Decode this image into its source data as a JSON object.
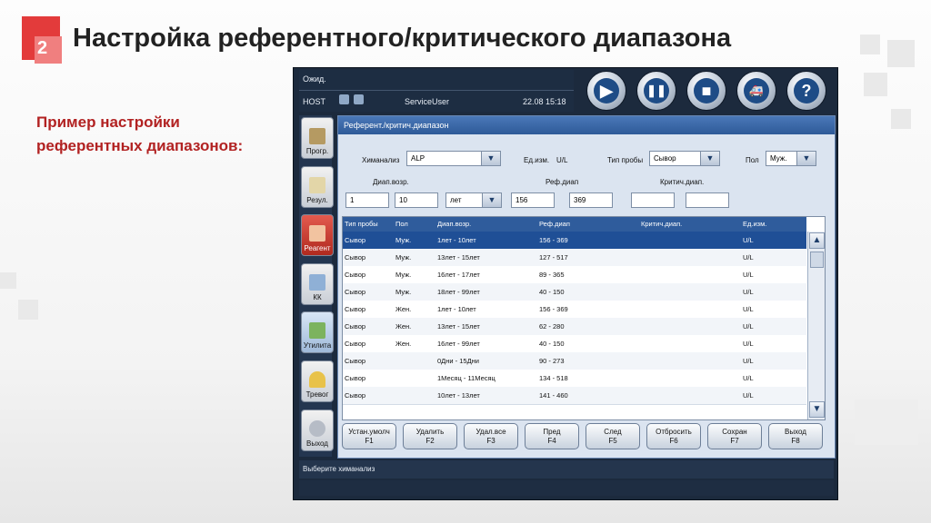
{
  "slide": {
    "number": "2",
    "title": "Настройка референтного/критического диапазона",
    "subtitle": "Пример настройки референтных диапазонов:"
  },
  "app": {
    "status_text": "Ожид.",
    "host": "HOST",
    "user": "ServiceUser",
    "datetime": "22.08 15:18",
    "controls": [
      {
        "name": "start",
        "glyph": "▶"
      },
      {
        "name": "pause",
        "glyph": "❚❚"
      },
      {
        "name": "stop",
        "glyph": "■"
      },
      {
        "name": "ambulance",
        "glyph": "🚑"
      },
      {
        "name": "help",
        "glyph": "?"
      }
    ],
    "nav": [
      {
        "label": "Прогр."
      },
      {
        "label": "Резул."
      },
      {
        "label": "Реагент"
      },
      {
        "label": "КК"
      },
      {
        "label": "Утилита"
      },
      {
        "label": "Тревог"
      },
      {
        "label": "Выход"
      }
    ],
    "panel_title": "Референт./критич.диапазон",
    "form": {
      "chem_label": "Химанализ",
      "chem_value": "ALP",
      "unit_label": "Ед.изм.",
      "unit_value": "U/L",
      "sample_type_label": "Тип пробы",
      "sample_type_value": "Сывор",
      "sex_label": "Пол",
      "sex_value": "Муж.",
      "age_range_label": "Диап.возр.",
      "ref_range_label": "Реф.диап",
      "crit_range_label": "Критич.диап.",
      "age_from": "1",
      "age_to": "10",
      "age_unit": "лет",
      "ref_low": "156",
      "ref_high": "369",
      "crit_low": "",
      "crit_high": ""
    },
    "table": {
      "columns": [
        "Тип пробы",
        "Пол",
        "Диап.возр.",
        "Реф.диап",
        "Критич.диап.",
        "Ед.изм."
      ],
      "rows": [
        [
          "Сывор",
          "Муж.",
          "1лет - 10лет",
          "156 - 369",
          "",
          "U/L"
        ],
        [
          "Сывор",
          "Муж.",
          "13лет - 15лет",
          "127 - 517",
          "",
          "U/L"
        ],
        [
          "Сывор",
          "Муж.",
          "16лет - 17лет",
          "89 - 365",
          "",
          "U/L"
        ],
        [
          "Сывор",
          "Муж.",
          "18лет - 99лет",
          "40 - 150",
          "",
          "U/L"
        ],
        [
          "Сывор",
          "Жен.",
          "1лет - 10лет",
          "156 - 369",
          "",
          "U/L"
        ],
        [
          "Сывор",
          "Жен.",
          "13лет - 15лет",
          "62 - 280",
          "",
          "U/L"
        ],
        [
          "Сывор",
          "Жен.",
          "16лет - 99лет",
          "40 - 150",
          "",
          "U/L"
        ],
        [
          "Сывор",
          "",
          "0Дни - 15Дни",
          "90 - 273",
          "",
          "U/L"
        ],
        [
          "Сывор",
          "",
          "1Месяц - 11Месяц",
          "134 - 518",
          "",
          "U/L"
        ],
        [
          "Сывор",
          "",
          "10лет - 13лет",
          "141 - 460",
          "",
          "U/L"
        ]
      ],
      "selected_row": 0
    },
    "buttons": [
      {
        "label": "Устан.умолч",
        "key": "F1"
      },
      {
        "label": "Удалить",
        "key": "F2"
      },
      {
        "label": "Удал.все",
        "key": "F3"
      },
      {
        "label": "Пред",
        "key": "F4"
      },
      {
        "label": "След",
        "key": "F5"
      },
      {
        "label": "Отбросить",
        "key": "F6"
      },
      {
        "label": "Сохран",
        "key": "F7"
      },
      {
        "label": "Выход",
        "key": "F8"
      }
    ],
    "status_message": "Выберите химанализ"
  }
}
